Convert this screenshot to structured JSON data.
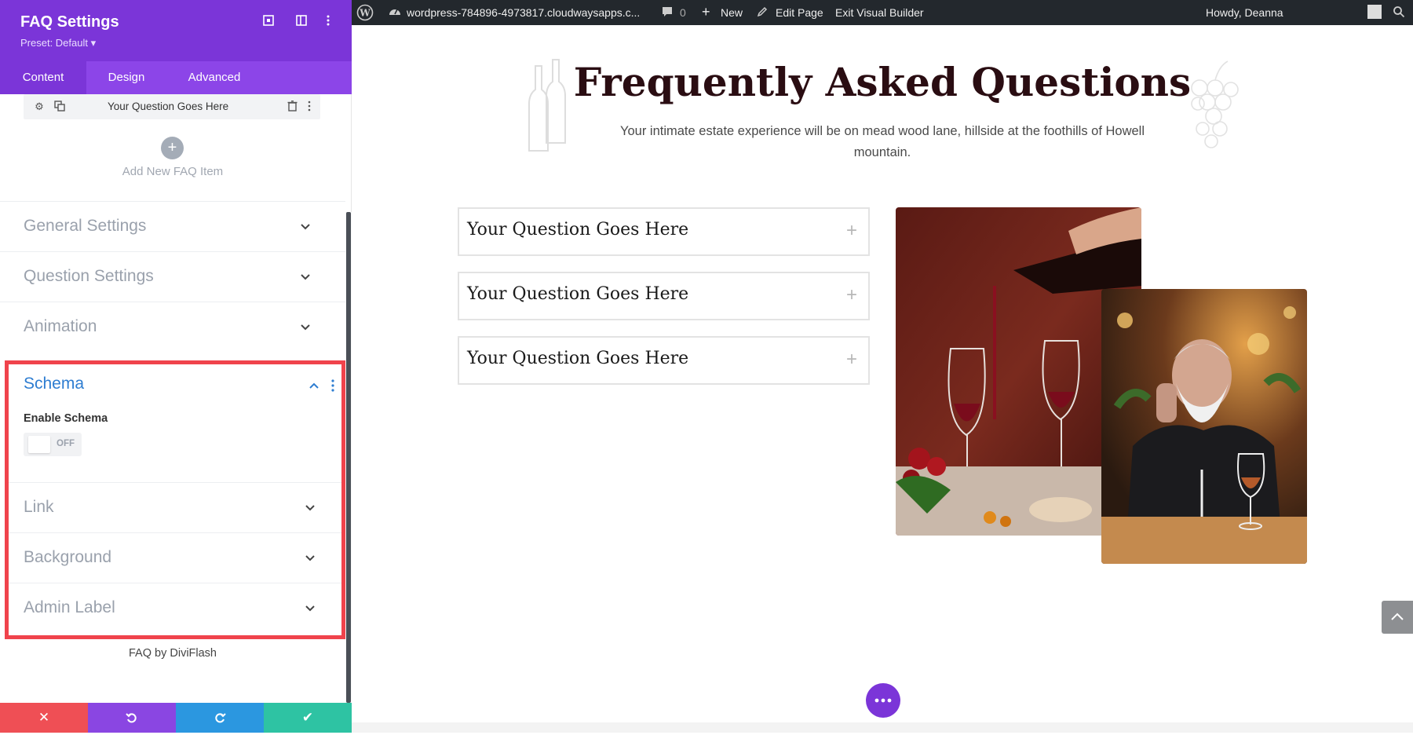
{
  "panel": {
    "title": "FAQ Settings",
    "preset": "Preset: Default ▾",
    "tabs": [
      {
        "label": "Content"
      },
      {
        "label": "Design"
      },
      {
        "label": "Advanced"
      }
    ],
    "faq_item_label": "Your Question Goes Here",
    "add_new_label": "Add New FAQ Item",
    "sections_top": [
      {
        "label": "General Settings"
      },
      {
        "label": "Question Settings"
      },
      {
        "label": "Animation"
      }
    ],
    "schema": {
      "title": "Schema",
      "enable_label": "Enable Schema",
      "toggle_state": "OFF"
    },
    "sections_bottom": [
      {
        "label": "Link"
      },
      {
        "label": "Background"
      },
      {
        "label": "Admin Label"
      }
    ],
    "brand": "FAQ by DiviFlash",
    "bottom_bar_colors": [
      "#ef4f55",
      "#8a46e2",
      "#2b97e0",
      "#2ec3a3"
    ]
  },
  "adminbar": {
    "site": "wordpress-784896-4973817.cloudwaysapps.c...",
    "comments": "0",
    "new": "New",
    "edit": "Edit Page",
    "exit": "Exit Visual Builder",
    "greeting": "Howdy, Deanna"
  },
  "page": {
    "heading": "Frequently Asked Questions",
    "subtitle": "Your intimate estate experience will be on mead wood lane, hillside at the foothills of Howell mountain.",
    "questions": [
      {
        "text": "Your Question Goes Here",
        "icon": "+"
      },
      {
        "text": "Your Question Goes Here",
        "icon": "+"
      },
      {
        "text": "Your Question Goes Here",
        "icon": "+"
      }
    ]
  },
  "colors": {
    "accent": "#7b35d8",
    "highlight": "#f0434c",
    "schema_blue": "#2e7dd1"
  }
}
